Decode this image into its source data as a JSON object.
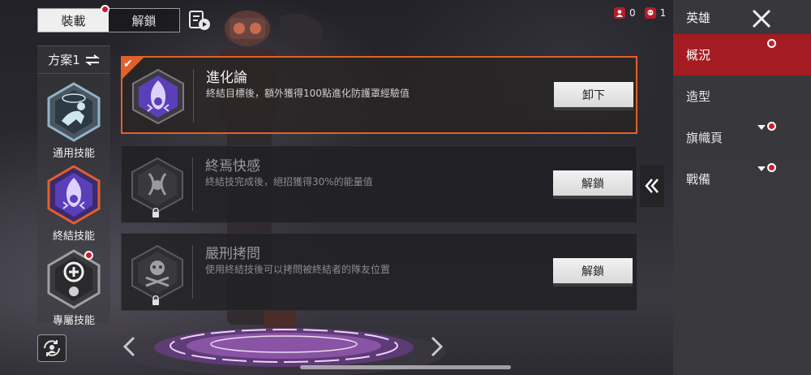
{
  "top_tabs": {
    "equipped": "裝載",
    "unlock": "解鎖"
  },
  "resources": [
    {
      "icon": "legend-token-icon",
      "value": "0"
    },
    {
      "icon": "skull-currency-icon",
      "value": "1"
    }
  ],
  "right_menu": {
    "title": "英雄",
    "items": [
      {
        "label": "概況",
        "active": true,
        "notification": true,
        "new_arrow": false
      },
      {
        "label": "造型",
        "active": false,
        "notification": false,
        "new_arrow": false
      },
      {
        "label": "旗幟頁",
        "active": false,
        "notification": true,
        "new_arrow": true
      },
      {
        "label": "戰備",
        "active": false,
        "notification": true,
        "new_arrow": true
      }
    ]
  },
  "preset": {
    "label": "方案1"
  },
  "categories": [
    {
      "label": "通用技能",
      "icon": "crawling-figure-icon"
    },
    {
      "label": "終結技能",
      "icon": "flame-skull-icon"
    },
    {
      "label": "專屬技能",
      "icon": "plus-skull-icon"
    }
  ],
  "skills": [
    {
      "name": "進化論",
      "desc": "終結目標後，額外獲得100點進化防護罩經驗值",
      "button": "卸下",
      "state": "equipped"
    },
    {
      "name": "終焉快感",
      "desc": "終結技完成後，絕招獲得30%的能量值",
      "button": "解鎖",
      "state": "locked"
    },
    {
      "name": "嚴刑拷問",
      "desc": "使用終結技後可以拷問被終結者的隊友位置",
      "button": "解鎖",
      "state": "locked"
    }
  ],
  "colors": {
    "accent_orange": "#e3602a",
    "menu_active_red": "#a51b22",
    "notification_red": "#d11a2a",
    "hex_purple": "#5b3fb8"
  }
}
